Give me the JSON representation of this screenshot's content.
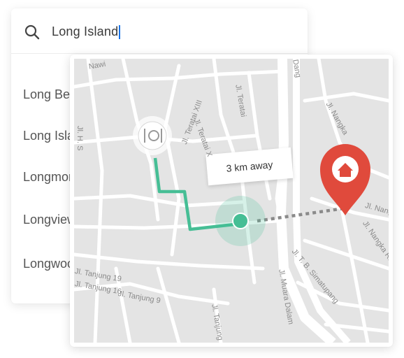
{
  "search": {
    "query": "Long Island",
    "icon": "search-icon"
  },
  "suggestions": [
    "Long Beach",
    "Long Island",
    "Longmont",
    "Longview",
    "Longwood"
  ],
  "map": {
    "distance_label": "3 km away",
    "origin_icon": "restaurant-icon",
    "destination_icon": "home-icon",
    "route_color": "#46be95",
    "pin_color": "#e04a3c",
    "streets": [
      "Jl. H. S",
      "Jl. Teratai XIII",
      "Jl. Teratai X",
      "Jl. Teratai",
      "Jl. Nangka",
      "Jl. T. B. Simatupang",
      "Jl. Muara Dalam",
      "Jl. Tanjung 19",
      "Jl. Tanjung 16",
      "Jl. Tanjung 9",
      "Jl. Tanjung",
      "Jl. Nangka Raya",
      "Jl. Nangka Raya",
      "Dang",
      "Nawi"
    ]
  },
  "colors": {
    "accent": "#1a73e8",
    "route": "#46be95",
    "pin": "#e04a3c"
  }
}
